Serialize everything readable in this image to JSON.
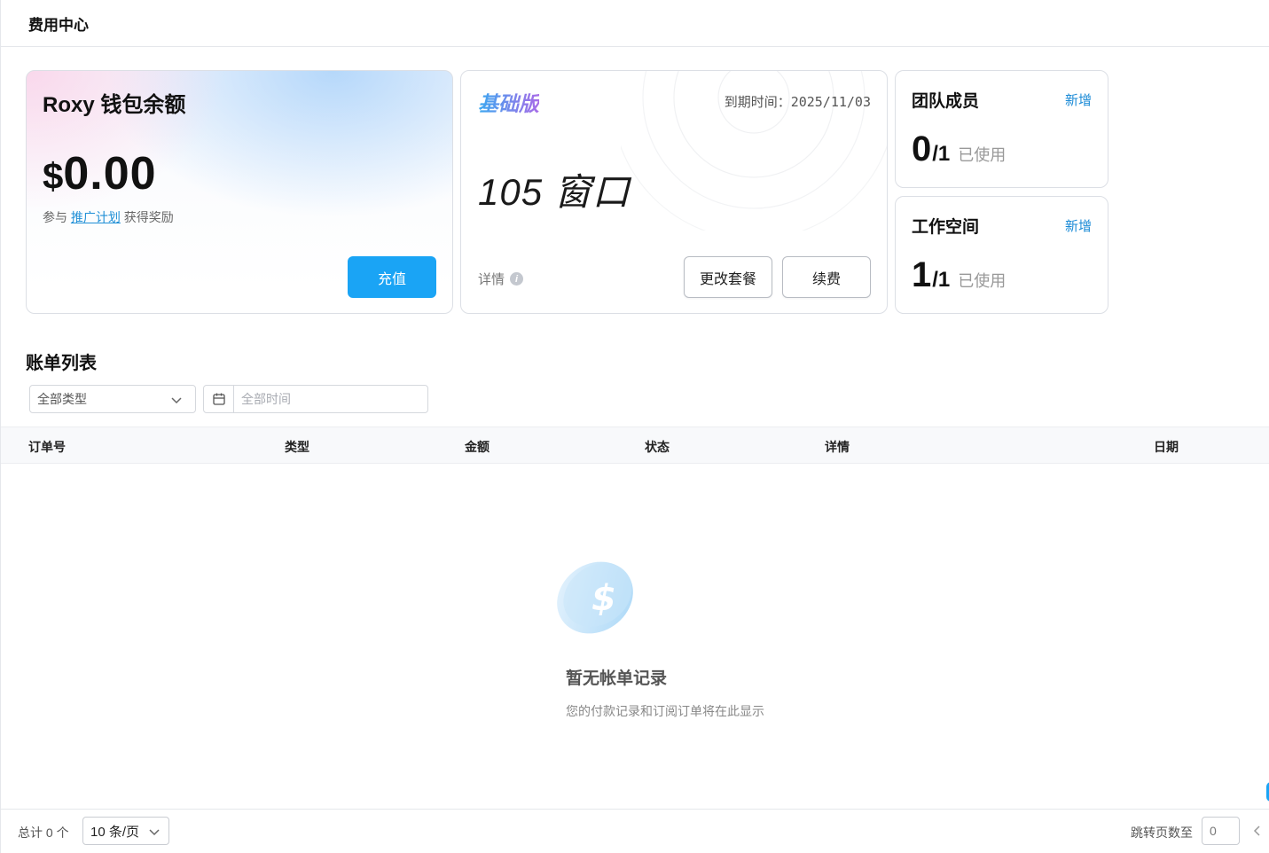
{
  "header": {
    "title": "费用中心"
  },
  "wallet": {
    "title": "Roxy 钱包余额",
    "currency": "$",
    "amount": "0.00",
    "note_prefix": "参与 ",
    "note_link": "推广计划",
    "note_suffix": " 获得奖励",
    "recharge_label": "充值"
  },
  "plan": {
    "name": "基础版",
    "expiry": "到期时间：2025/11/03",
    "windows": "105 窗口",
    "detail_label": "详情",
    "change_label": "更改套餐",
    "renew_label": "续费"
  },
  "team": {
    "title": "团队成员",
    "add_label": "新增",
    "used": "0",
    "total": "/1",
    "used_label": "已使用"
  },
  "workspace": {
    "title": "工作空间",
    "add_label": "新增",
    "used": "1",
    "total": "/1",
    "used_label": "已使用"
  },
  "bills": {
    "title": "账单列表",
    "type_filter": "全部类型",
    "time_placeholder": "全部时间",
    "columns": [
      "订单号",
      "类型",
      "金额",
      "状态",
      "详情",
      "日期"
    ],
    "empty_title": "暂无帐单记录",
    "empty_sub": "您的付款记录和订阅订单将在此显示"
  },
  "pagination": {
    "total": "总计 0 个",
    "page_size": "10 条/页",
    "jump_label": "跳转页数至",
    "jump_value": "0"
  },
  "colors": {
    "primary": "#1aa4f5",
    "link": "#1a8ad6"
  }
}
